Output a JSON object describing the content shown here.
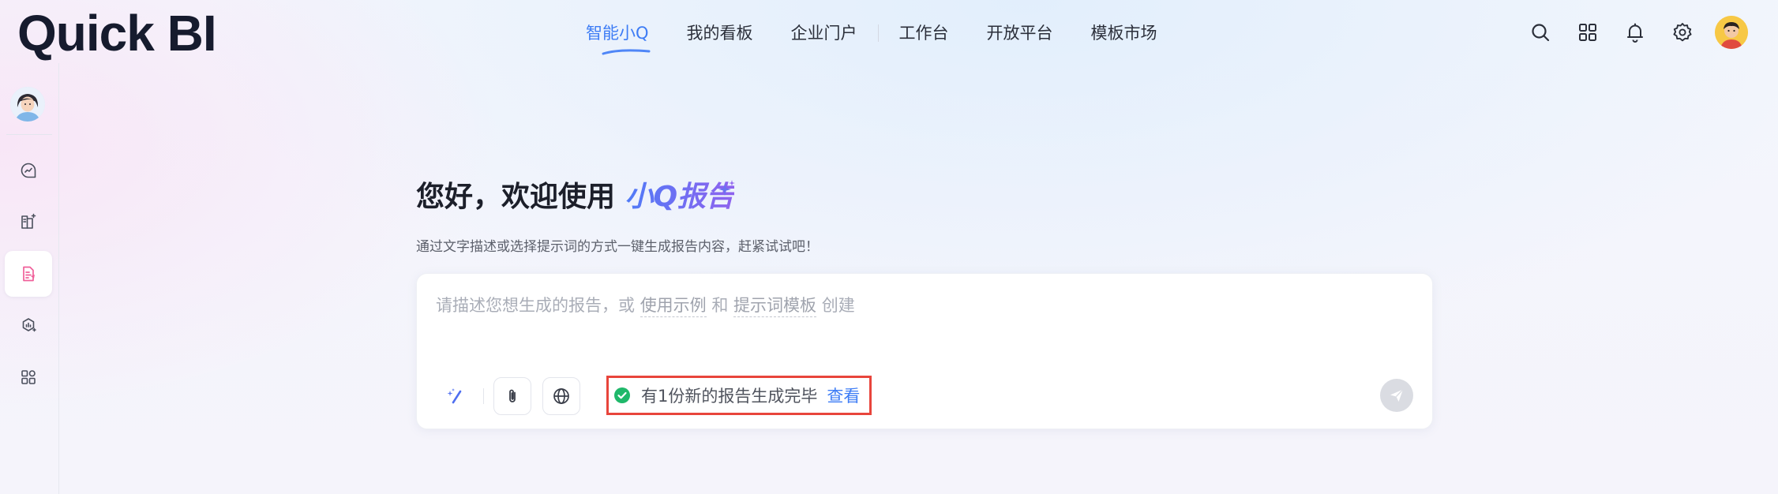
{
  "app": {
    "logo_text": "Quick BI"
  },
  "nav": {
    "tabs": [
      {
        "label": "智能小Q",
        "active": true
      },
      {
        "label": "我的看板",
        "active": false
      },
      {
        "label": "企业门户",
        "active": false
      },
      {
        "label": "工作台",
        "active": false
      },
      {
        "label": "开放平台",
        "active": false
      },
      {
        "label": "模板市场",
        "active": false
      }
    ],
    "icons": [
      "search-icon",
      "apps-grid-icon",
      "bell-icon",
      "settings-gear-icon",
      "user-avatar"
    ]
  },
  "sidebar": {
    "items": [
      {
        "icon": "chat-analysis-icon",
        "active": false
      },
      {
        "icon": "book-sparkle-icon",
        "active": false
      },
      {
        "icon": "report-doc-icon",
        "active": true
      },
      {
        "icon": "data-insight-icon",
        "active": false
      },
      {
        "icon": "apps-icon",
        "active": false
      }
    ]
  },
  "main": {
    "heading_prefix": "您好，欢迎使用 ",
    "heading_accent": "小Q报告",
    "subheading": "通过文字描述或选择提示词的方式一键生成报告内容，赶紧试试吧！",
    "prompt": {
      "placeholder_part1": "请描述您想生成的报告，或 ",
      "link_examples": "使用示例",
      "placeholder_and": " 和 ",
      "link_templates": "提示词模板",
      "placeholder_part2": " 创建"
    },
    "notice": {
      "text": "有1份新的报告生成完毕",
      "link": "查看"
    }
  },
  "colors": {
    "accent": "#3d7cf5",
    "heading_gradient_start": "#4f7bf7",
    "heading_gradient_end": "#8f62ee",
    "sidebar_active_icon": "#f0609a",
    "success": "#1fb86a",
    "notice_highlight_border": "#e8453c"
  }
}
